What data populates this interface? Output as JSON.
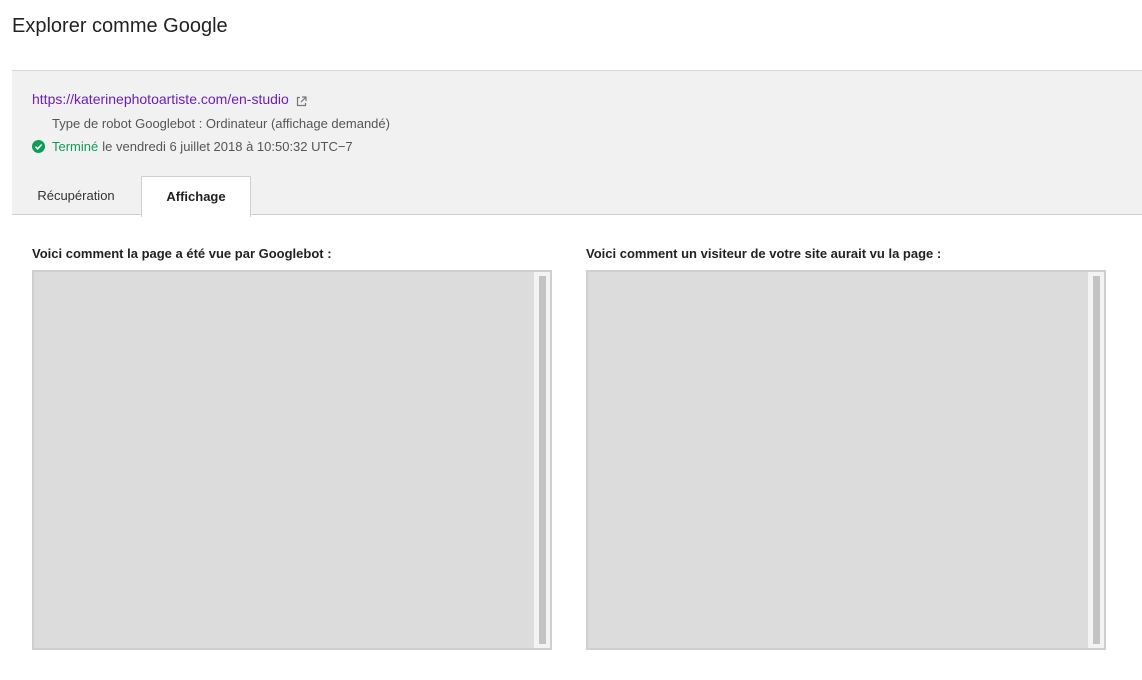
{
  "page": {
    "title": "Explorer comme Google"
  },
  "info": {
    "url": "https://katerinephotoartiste.com/en-studio",
    "robot_type": "Type de robot Googlebot : Ordinateur (affichage demandé)",
    "status_word": "Terminé",
    "status_date": "le vendredi 6 juillet 2018 à 10:50:32 UTC−7",
    "status_color": "#0f9d58",
    "link_color": "#6b1fb8"
  },
  "tabs": [
    {
      "label": "Récupération",
      "active": false
    },
    {
      "label": "Affichage",
      "active": true
    }
  ],
  "panels": {
    "googlebot_label": "Voici comment la page a été vue par Googlebot :",
    "visitor_label": "Voici comment un visiteur de votre site aurait vu la page :"
  },
  "icons": {
    "external": "external-link-icon",
    "status": "check-circle-icon"
  }
}
